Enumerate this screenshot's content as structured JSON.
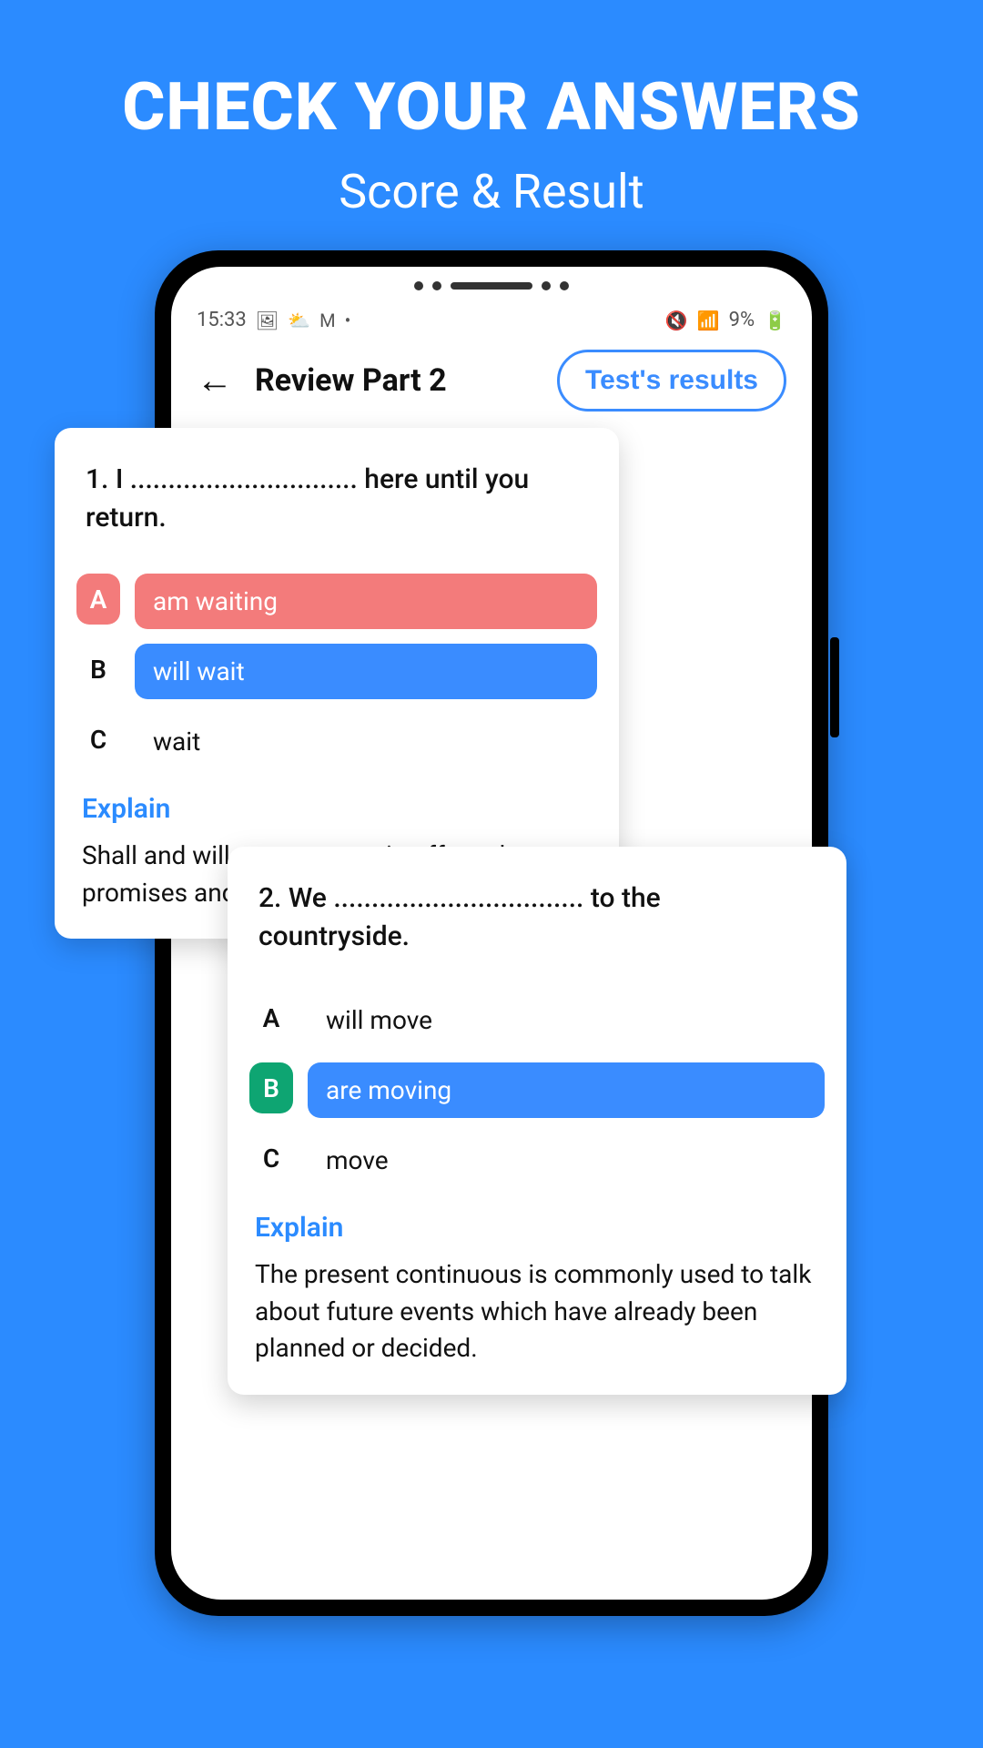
{
  "hero": {
    "title": "CHECK YOUR ANSWERS",
    "subtitle": "Score & Result"
  },
  "status": {
    "time": "15:33",
    "battery": "9%"
  },
  "header": {
    "title": "Review Part 2",
    "results_button": "Test's results"
  },
  "q1": {
    "text": "1. I .............................. here until you return.",
    "options": [
      {
        "letter": "A",
        "text": "am waiting"
      },
      {
        "letter": "B",
        "text": "will wait"
      },
      {
        "letter": "C",
        "text": "wait"
      }
    ],
    "explain_label": "Explain",
    "explain_text": "Shall and will are common in offers, threats, promises and announcements of decisions."
  },
  "q2": {
    "text": "2. We ................................. to the countryside.",
    "options": [
      {
        "letter": "A",
        "text": "will move"
      },
      {
        "letter": "B",
        "text": "are moving"
      },
      {
        "letter": "C",
        "text": "move"
      }
    ],
    "explain_label": "Explain",
    "explain_text": "The present continuous is commonly used to talk about future events which have already been planned or decided."
  }
}
